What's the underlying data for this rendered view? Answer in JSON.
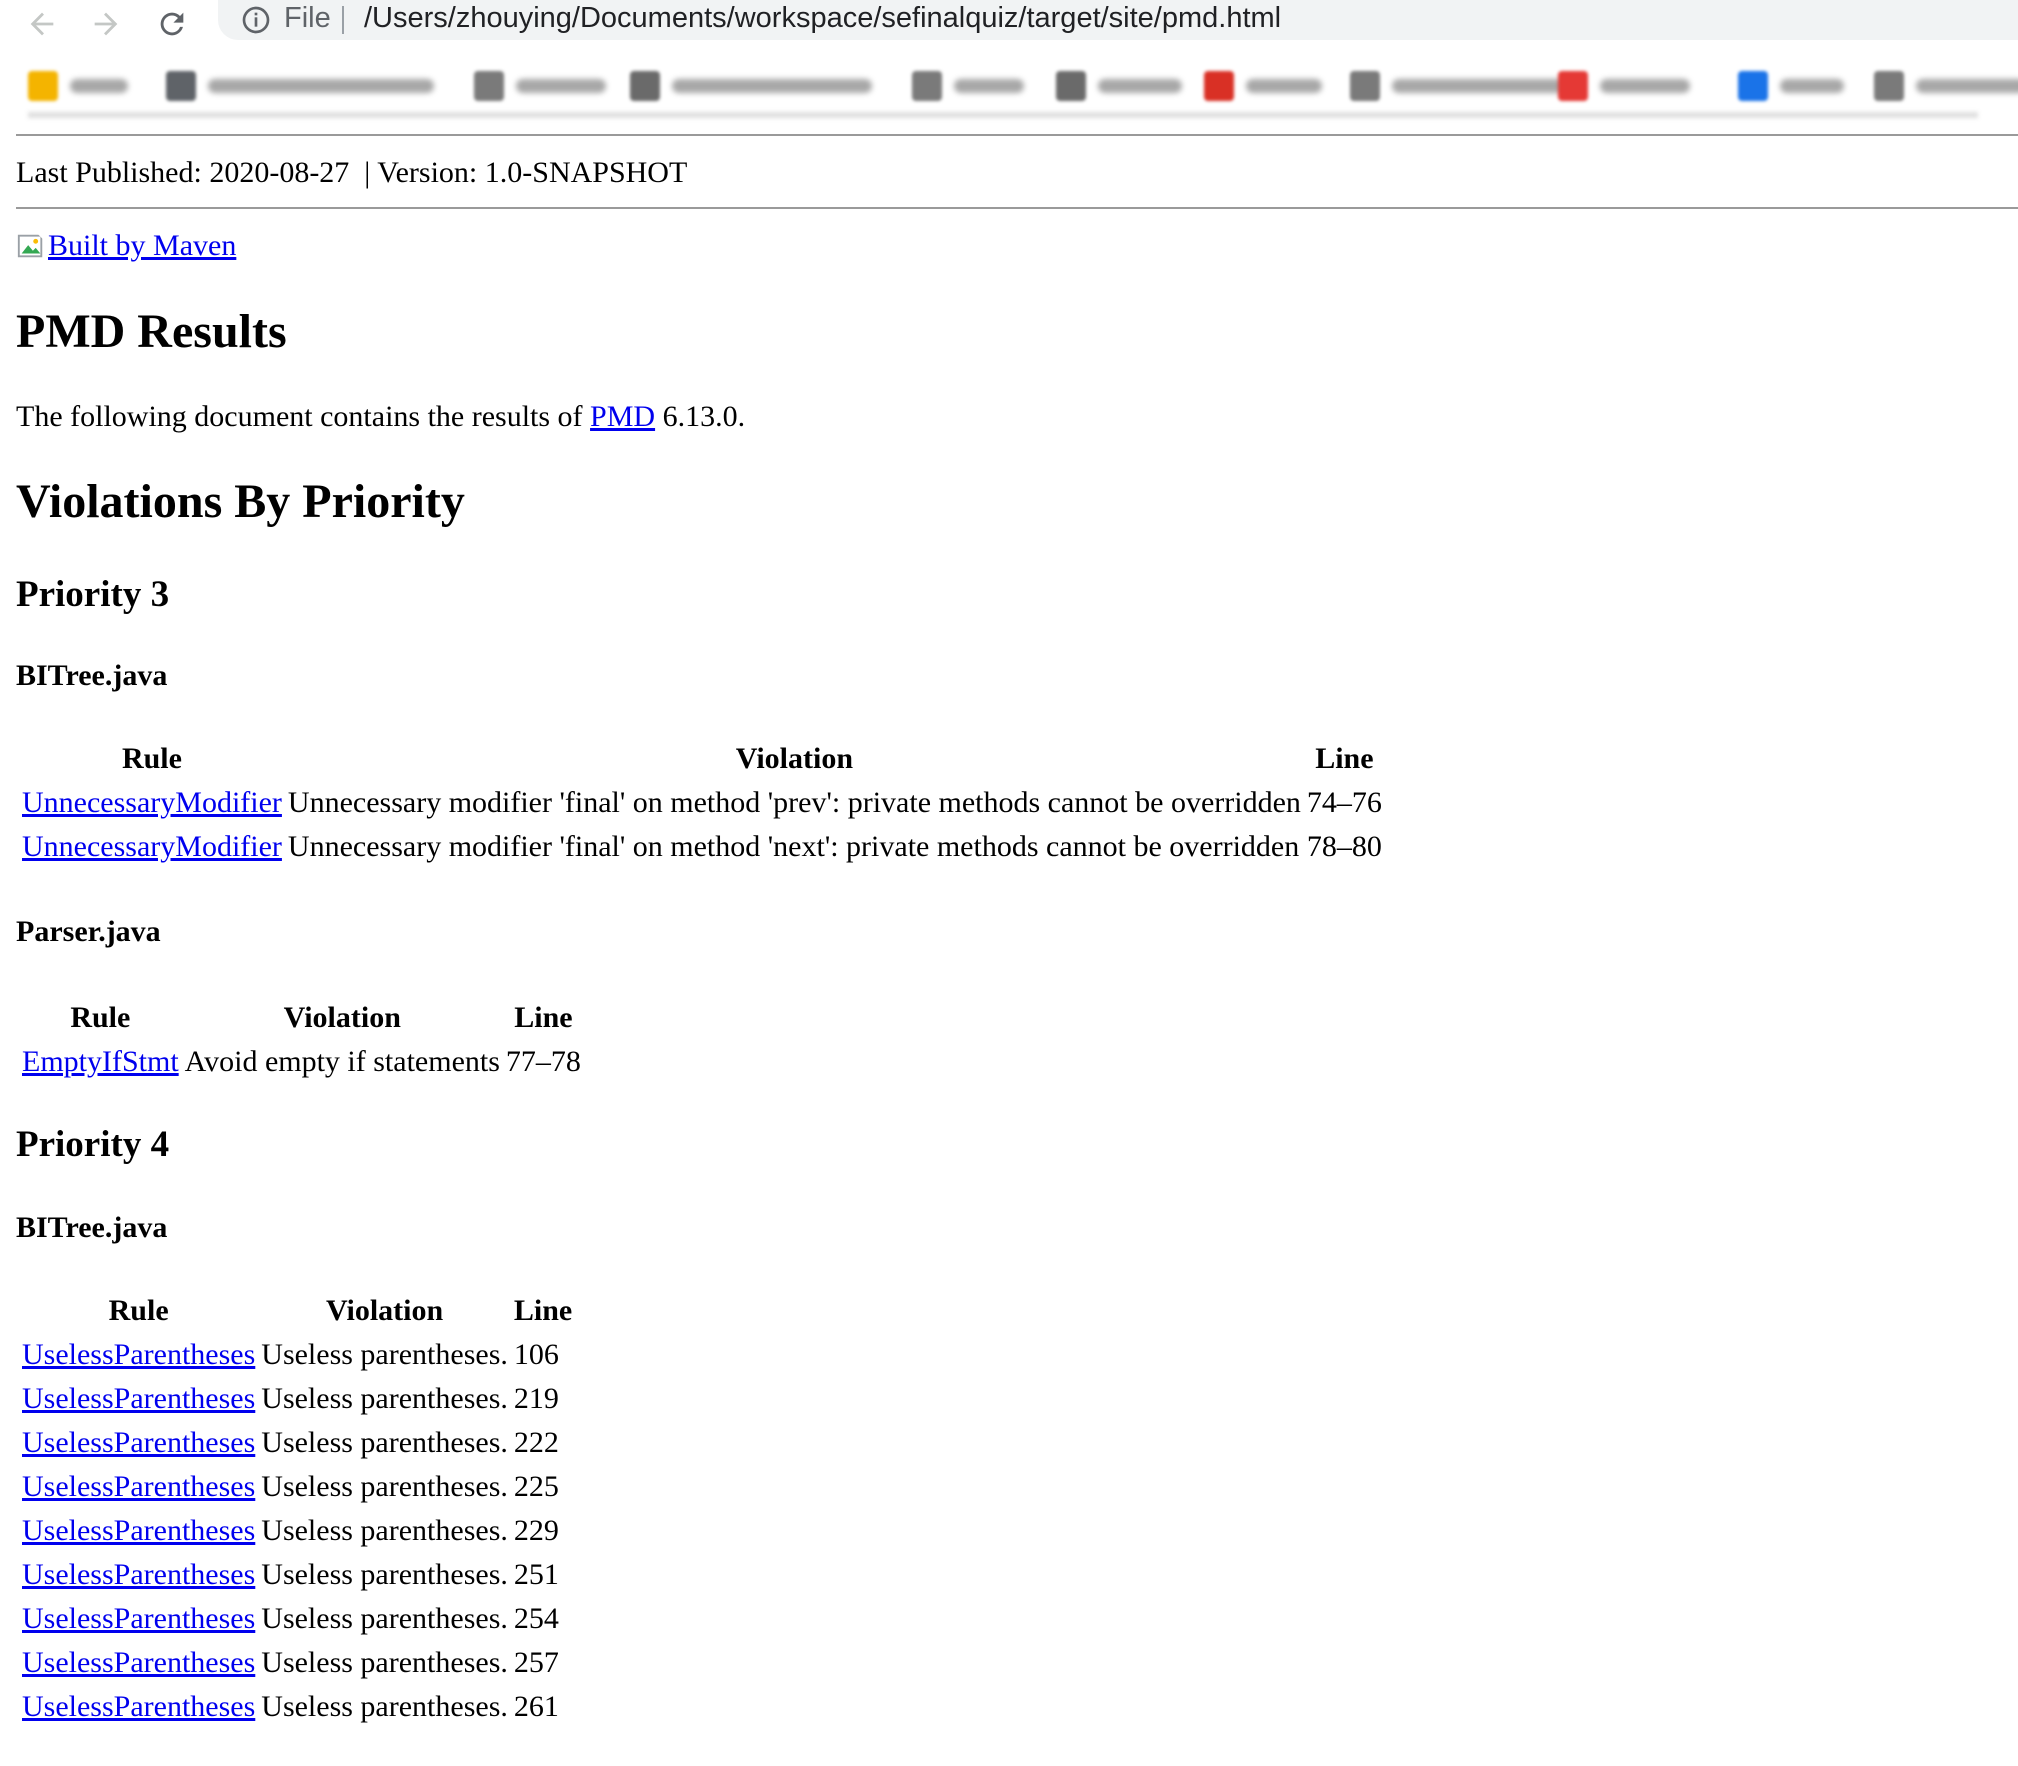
{
  "browser": {
    "scheme_label": "File",
    "url": "/Users/zhouying/Documents/workspace/sefinalquiz/target/site/pmd.html"
  },
  "bookmark_colors": [
    "#f4b400",
    "#5f6368",
    "#7a7a7a",
    "#6a6a6a",
    "#7a7a7a",
    "#6a6a6a",
    "#d93025",
    "#7a7a7a",
    "#e53935",
    "#1a73e8",
    "#7a7a7a"
  ],
  "page": {
    "last_published": "Last Published: 2020-08-27  | Version: 1.0-SNAPSHOT",
    "built_by": "Built by Maven",
    "title": "PMD Results",
    "intro_before": "The following document contains the results of ",
    "intro_link": "PMD",
    "intro_after": " 6.13.0.",
    "violations_heading": "Violations By Priority"
  },
  "columns": {
    "rule": "Rule",
    "violation": "Violation",
    "line": "Line"
  },
  "priorities": [
    {
      "heading": "Priority 3",
      "files": [
        {
          "name": "BITree.java",
          "rows": [
            {
              "rule": "UnnecessaryModifier",
              "violation": "Unnecessary modifier 'final' on method 'prev': private methods cannot be overridden",
              "line": "74–76"
            },
            {
              "rule": "UnnecessaryModifier",
              "violation": "Unnecessary modifier 'final' on method 'next': private methods cannot be overridden",
              "line": "78–80"
            }
          ]
        },
        {
          "name": "Parser.java",
          "rows": [
            {
              "rule": "EmptyIfStmt",
              "violation": "Avoid empty if statements",
              "line": "77–78"
            }
          ]
        }
      ]
    },
    {
      "heading": "Priority 4",
      "files": [
        {
          "name": "BITree.java",
          "rows": [
            {
              "rule": "UselessParentheses",
              "violation": "Useless parentheses.",
              "line": "106"
            },
            {
              "rule": "UselessParentheses",
              "violation": "Useless parentheses.",
              "line": "219"
            },
            {
              "rule": "UselessParentheses",
              "violation": "Useless parentheses.",
              "line": "222"
            },
            {
              "rule": "UselessParentheses",
              "violation": "Useless parentheses.",
              "line": "225"
            },
            {
              "rule": "UselessParentheses",
              "violation": "Useless parentheses.",
              "line": "229"
            },
            {
              "rule": "UselessParentheses",
              "violation": "Useless parentheses.",
              "line": "251"
            },
            {
              "rule": "UselessParentheses",
              "violation": "Useless parentheses.",
              "line": "254"
            },
            {
              "rule": "UselessParentheses",
              "violation": "Useless parentheses.",
              "line": "257"
            },
            {
              "rule": "UselessParentheses",
              "violation": "Useless parentheses.",
              "line": "261"
            }
          ]
        }
      ]
    }
  ]
}
